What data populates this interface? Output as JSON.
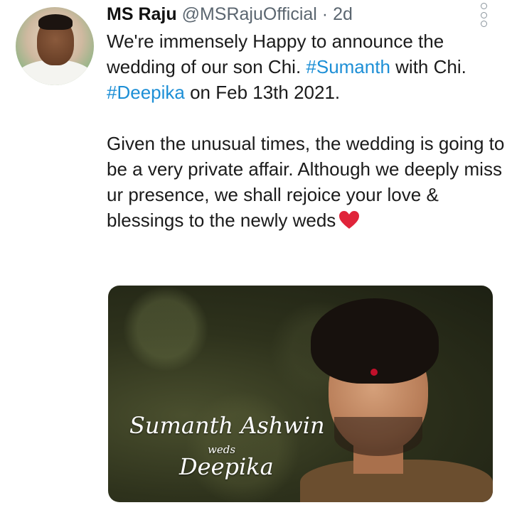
{
  "tweet": {
    "author_name": "MS Raju",
    "handle": "@MSRajuOfficial",
    "separator": "·",
    "time": "2d",
    "paragraph1": {
      "part1": "We're immensely Happy to announce the wedding of our son Chi. ",
      "hashtag1": "#Sumanth",
      "part2": " with Chi. ",
      "hashtag2": "#Deepika",
      "part3": " on Feb 13th 2021."
    },
    "paragraph2": "Given the unusual times, the wedding is going to be a very private affair. Although we deeply miss ur presence, we shall rejoice your love & blessings to the newly weds",
    "heart_icon": "red-heart-icon"
  },
  "media": {
    "line1": "Sumanth Ashwin",
    "line_small": "weds",
    "line2": "Deepika"
  },
  "colors": {
    "hashtag": "#1d8fd6",
    "heart": "#e0243a",
    "handle": "#5b6670"
  }
}
